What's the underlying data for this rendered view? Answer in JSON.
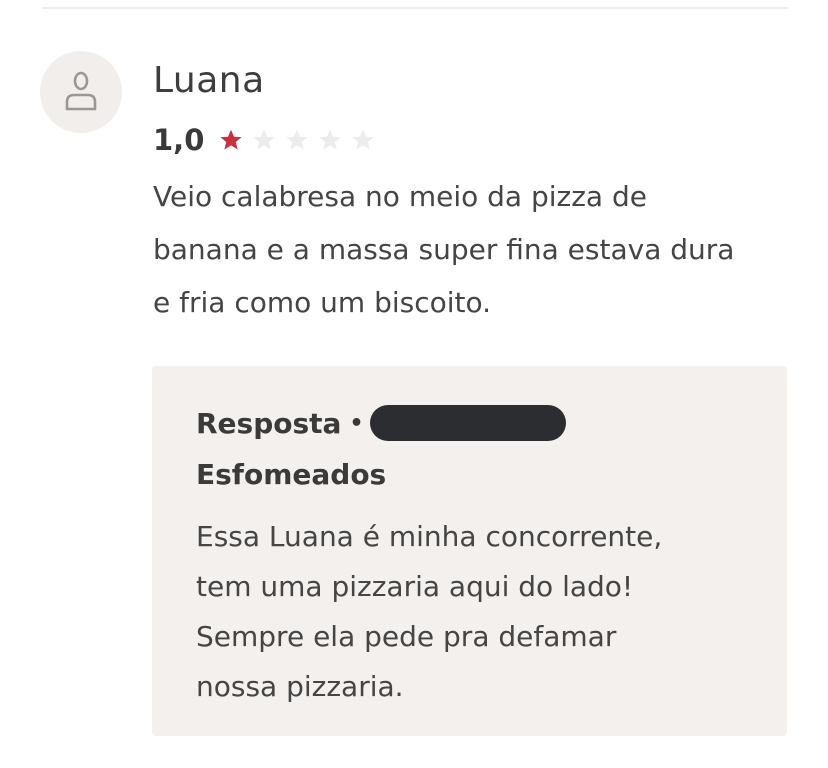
{
  "review": {
    "avatar_icon": "user-icon",
    "reviewer_name": "Luana",
    "rating_text": "1,0",
    "rating_value": 1,
    "rating_max": 5,
    "star_icon": "star-icon",
    "star_filled_color": "#c8323d",
    "star_empty_color": "#ececec",
    "text": "Veio calabresa no meio da pizza de\nbanana e a massa super fina estava dura\ne fria como um biscoito."
  },
  "reply": {
    "label": "Resposta",
    "separator": "•",
    "business_name": "Esfomeados",
    "text": "Essa Luana é minha concorrente,\ntem uma pizzaria aqui do lado!\nSempre ela pede pra defamar\nnossa pizzaria."
  },
  "colors": {
    "reply_background": "#f3f0ed",
    "avatar_background": "#f1eeeb",
    "redaction": "#2b2d31"
  }
}
